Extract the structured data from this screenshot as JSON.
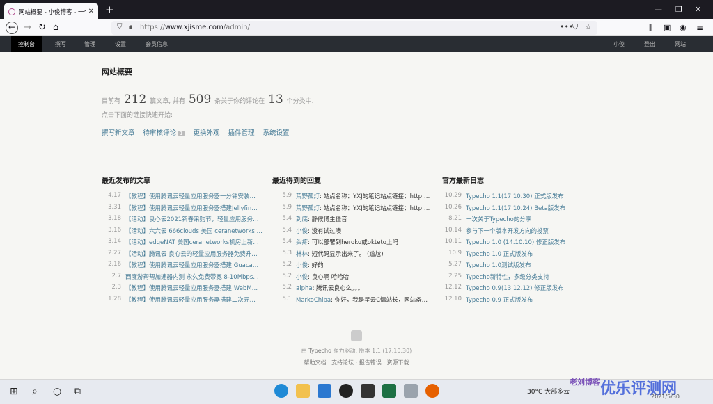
{
  "browser": {
    "tab_title": "网站概要 - 小俊博客 - 一个从小",
    "url_scheme": "https://",
    "url_host": "www.xjisme.com",
    "url_path": "/admin/"
  },
  "adminbar": {
    "items": [
      "控制台",
      "撰写",
      "管理",
      "设置",
      "会员信息"
    ],
    "right": [
      "小俊",
      "登出",
      "网站"
    ]
  },
  "page": {
    "title": "网站概要",
    "stats_prefix": "目前有",
    "posts": "212",
    "stats_mid1": "篇文章, 并有",
    "comments": "509",
    "stats_mid2": "条关于你的评论在",
    "categories": "13",
    "stats_suffix": "个分类中.",
    "hint": "点击下面的链接快速开始:",
    "quick_links": [
      "撰写新文章",
      "待审核评论",
      "更换外观",
      "插件管理",
      "系统设置"
    ],
    "pending_badge": "1"
  },
  "recent_posts": {
    "heading": "最近发布的文章",
    "items": [
      {
        "date": "4.17",
        "title": "【教程】使用腾讯云轻量应用服务器一分钟安装…"
      },
      {
        "date": "3.31",
        "title": "【教程】使用腾讯云轻量应用服务器搭建Jellyfin…"
      },
      {
        "date": "3.18",
        "title": "【活动】良心云2021新春采购节，轻量应用服务…"
      },
      {
        "date": "3.16",
        "title": "【活动】六六云 666clouds 美国 ceranetworks …"
      },
      {
        "date": "3.14",
        "title": "【活动】edgeNAT 美国ceranetworks机房上新…"
      },
      {
        "date": "2.27",
        "title": "【活动】腾讯云 良心云的轻量应用服务器免费升…"
      },
      {
        "date": "2.16",
        "title": "【教程】使用腾讯云轻量应用服务器搭建 Guaca…"
      },
      {
        "date": "2.7",
        "title": "西度游帮帮加速器内测 永久免费带宽 8-10Mbps…"
      },
      {
        "date": "2.3",
        "title": "【教程】使用腾讯云轻量应用服务器搭建 WebM…"
      },
      {
        "date": "1.28",
        "title": "【教程】使用腾讯云轻量应用服务器搭建二次元…"
      }
    ]
  },
  "recent_comments": {
    "heading": "最近得到的回复",
    "items": [
      {
        "date": "5.9",
        "author": "荒野孤灯",
        "text": "站点名称：YXJ的笔记站点链接：http:…"
      },
      {
        "date": "5.9",
        "author": "荒野孤灯",
        "text": "站点名称：YXJ的笔记站点链接：http:…"
      },
      {
        "date": "5.4",
        "author": "到底",
        "text": "静候博主佳音"
      },
      {
        "date": "5.4",
        "author": "小俊",
        "text": "没有试过噢"
      },
      {
        "date": "5.4",
        "author": "头疼",
        "text": "可以部署到heroku或okteto上吗"
      },
      {
        "date": "5.3",
        "author": "林林",
        "text": "短代码显示出来了。:(尴尬)"
      },
      {
        "date": "5.2",
        "author": "小俊",
        "text": "好的"
      },
      {
        "date": "5.2",
        "author": "小俊",
        "text": "良心啊 哈哈哈"
      },
      {
        "date": "5.2",
        "author": "alpha",
        "text": "腾讯云良心么。。。"
      },
      {
        "date": "5.1",
        "author": "MarkoChiba",
        "text": "你好，我是星云C情站长，网站备…"
      }
    ]
  },
  "official_news": {
    "heading": "官方最新日志",
    "items": [
      {
        "date": "10.29",
        "title": "Typecho 1.1(17.10.30) 正式版发布"
      },
      {
        "date": "10.26",
        "title": "Typecho 1.1(17.10.24) Beta版发布"
      },
      {
        "date": "8.21",
        "title": "一次关于Typecho的分享"
      },
      {
        "date": "10.14",
        "title": "参与下一个版本开发方向的投票"
      },
      {
        "date": "10.11",
        "title": "Typecho 1.0 (14.10.10) 修正版发布"
      },
      {
        "date": "10.9",
        "title": "Typecho 1.0 正式版发布"
      },
      {
        "date": "5.27",
        "title": "Typecho 1.0测试版发布"
      },
      {
        "date": "2.25",
        "title": "Typecho新特性，多级分类支持"
      },
      {
        "date": "12.12",
        "title": "Typecho 0.9(13.12.12) 修正版发布"
      },
      {
        "date": "12.10",
        "title": "Typecho 0.9 正式版发布"
      }
    ]
  },
  "footer": {
    "powered_prefix": "由",
    "powered_link": "Typecho",
    "powered_suffix": "强力驱动, 版本 1.1 (17.10.30)",
    "links": [
      "帮助文档",
      "支持论坛",
      "报告错误",
      "资源下载"
    ]
  },
  "taskbar": {
    "weather": "30°C 大部多云",
    "date": "2021/5/30"
  },
  "watermark": {
    "small": "老刘博客",
    "big": "优乐评测网"
  },
  "colors": {
    "adminbar_bg": "#292d33",
    "link": "#467b96",
    "page_bg": "#f6f6f3"
  }
}
